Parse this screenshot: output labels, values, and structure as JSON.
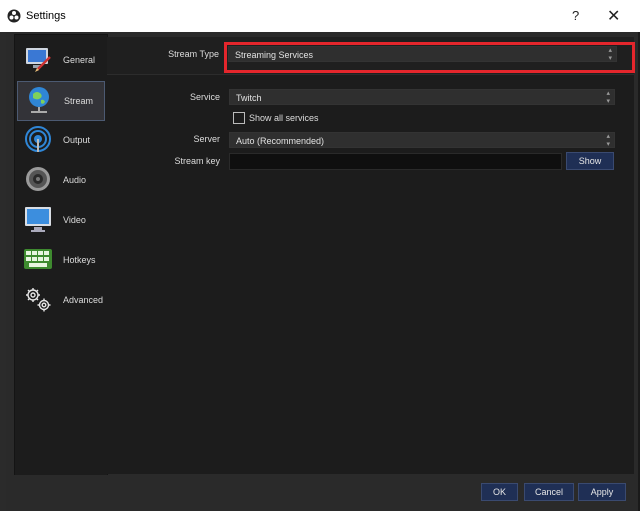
{
  "window": {
    "title": "Settings",
    "help_glyph": "?",
    "close_glyph": "✕"
  },
  "sidebar": {
    "items": [
      {
        "label": "General",
        "icon": "monitor-pen-icon"
      },
      {
        "label": "Stream",
        "icon": "globe-network-icon",
        "active": true
      },
      {
        "label": "Output",
        "icon": "broadcast-signal-icon"
      },
      {
        "label": "Audio",
        "icon": "speaker-icon"
      },
      {
        "label": "Video",
        "icon": "monitor-icon"
      },
      {
        "label": "Hotkeys",
        "icon": "keyboard-icon"
      },
      {
        "label": "Advanced",
        "icon": "gears-icon"
      }
    ]
  },
  "stream": {
    "stream_type_label": "Stream Type",
    "stream_type_value": "Streaming Services",
    "service_label": "Service",
    "service_value": "Twitch",
    "show_all_label": "Show all services",
    "show_all_checked": false,
    "server_label": "Server",
    "server_value": "Auto (Recommended)",
    "stream_key_label": "Stream key",
    "stream_key_value": "",
    "show_button": "Show"
  },
  "footer": {
    "ok": "OK",
    "cancel": "Cancel",
    "apply": "Apply"
  },
  "colors": {
    "highlight": "#e4262c",
    "button_blue": "#1f2f55",
    "background": "#1c1c1c"
  }
}
